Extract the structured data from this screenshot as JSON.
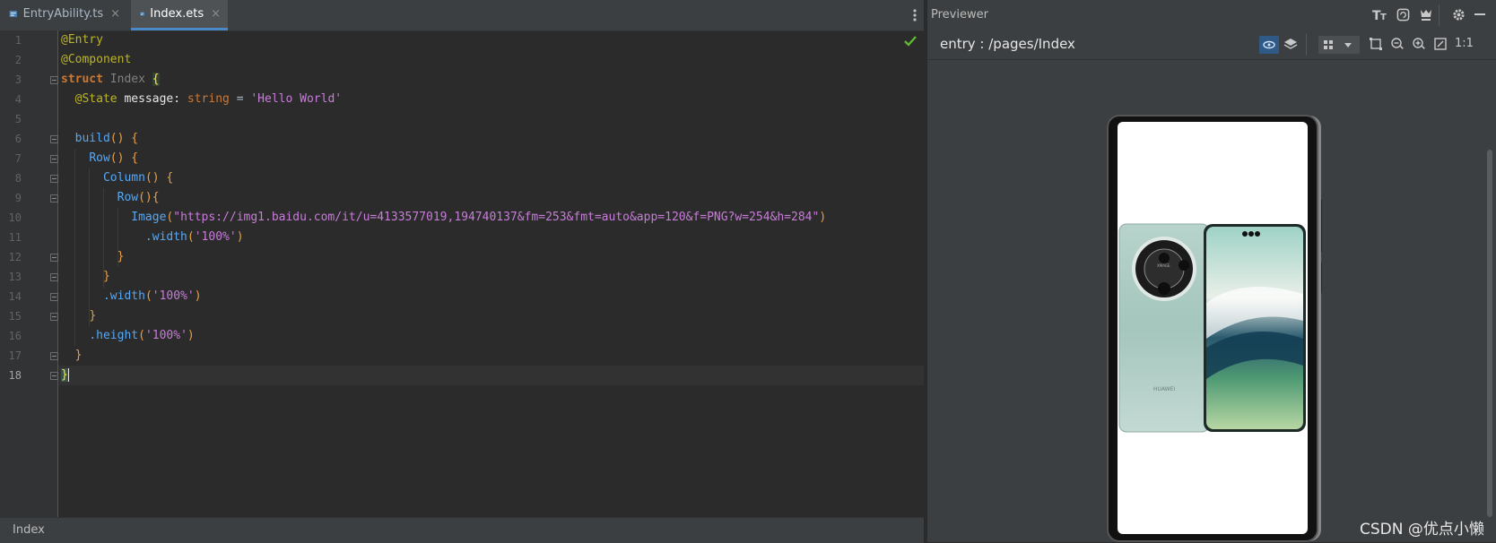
{
  "editor": {
    "tabs": [
      {
        "label": "EntryAbility.ts",
        "active": false
      },
      {
        "label": "Index.ets",
        "active": true
      }
    ],
    "close_glyph": "×",
    "breadcrumb": "Index",
    "line_numbers": [
      "1",
      "2",
      "3",
      "4",
      "5",
      "6",
      "7",
      "8",
      "9",
      "10",
      "11",
      "12",
      "13",
      "14",
      "15",
      "16",
      "17",
      "18"
    ],
    "code": {
      "l1": "@Entry",
      "l2": "@Component",
      "l3_kw": "struct ",
      "l3_name": "Index ",
      "l3_brace": "{",
      "l4_ann": "@State ",
      "l4_var": "message: ",
      "l4_type": "string",
      "l4_eq": " = ",
      "l4_str": "'Hello World'",
      "l6_fn": "build",
      "l6_rest": "() ",
      "l6_brace": "{",
      "l7_fn": "Row",
      "l7_rest": "() ",
      "l7_brace": "{",
      "l8_fn": "Column",
      "l8_rest": "() ",
      "l8_brace": "{",
      "l9_fn": "Row",
      "l9_rest": "()",
      "l9_brace": "{",
      "l10_fn": "Image",
      "l10_open": "(",
      "l10_url": "\"https://img1.baidu.com/it/u=4133577019,194740137&fm=253&fmt=auto&app=120&f=PNG?w=254&h=284\"",
      "l10_close": ")",
      "l11_fn": ".width",
      "l11_open": "(",
      "l11_str": "'100%'",
      "l11_close": ")",
      "l12": "}",
      "l13": "}",
      "l14_fn": ".width",
      "l14_open": "(",
      "l14_str": "'100%'",
      "l14_close": ")",
      "l15": "}",
      "l16_fn": ".height",
      "l16_open": "(",
      "l16_str": "'100%'",
      "l16_close": ")",
      "l17": "}",
      "l18": "}"
    }
  },
  "previewer": {
    "title": "Previewer",
    "route": "entry : /pages/Index",
    "scale_label": "1:1",
    "phone_brand": "HUAWEI"
  },
  "watermark": "CSDN @优点小懒",
  "colors": {
    "accent": "#4a88c7",
    "check": "#5fb832"
  },
  "icons": [
    "file-ts-icon",
    "more-vert-icon",
    "check-icon",
    "font-size-icon",
    "refresh-icon",
    "hot-reload-icon",
    "settings-icon",
    "minimize-icon",
    "eye-icon",
    "layers-icon",
    "grid-icon",
    "dropdown-icon",
    "crop-icon",
    "zoom-out-icon",
    "zoom-in-icon",
    "fit-icon"
  ]
}
